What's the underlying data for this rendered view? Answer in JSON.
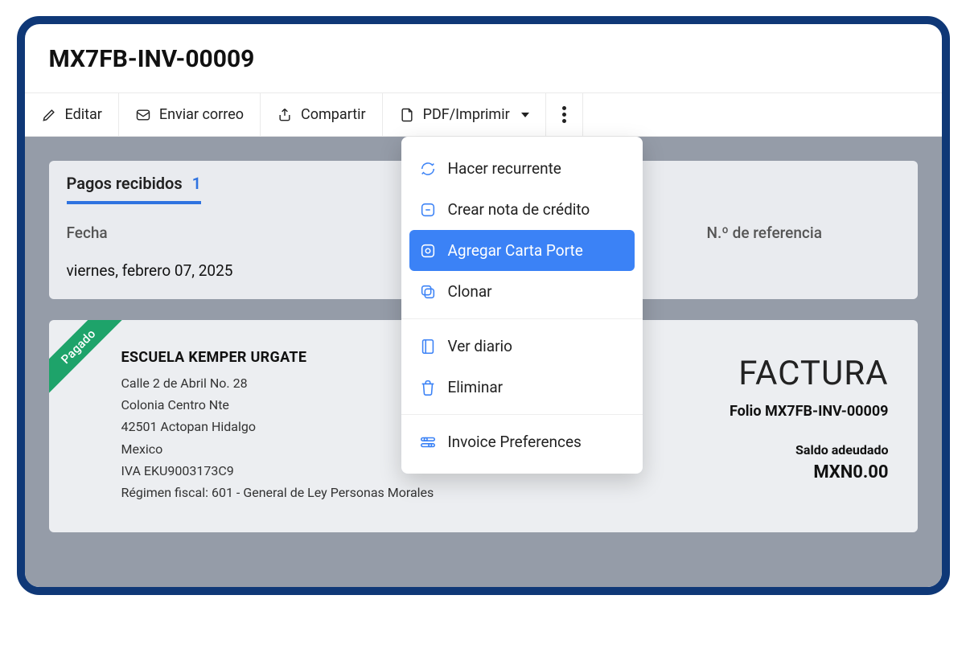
{
  "header": {
    "title": "MX7FB-INV-00009"
  },
  "toolbar": {
    "edit": "Editar",
    "email": "Enviar correo",
    "share": "Compartir",
    "pdf": "PDF/Imprimir"
  },
  "dropdown": {
    "recurring": "Hacer recurrente",
    "credit_note": "Crear nota de crédito",
    "carta_porte": "Agregar Carta Porte",
    "clone": "Clonar",
    "journal": "Ver diario",
    "delete": "Eliminar",
    "preferences": "Invoice Preferences"
  },
  "payments": {
    "tab_label": "Pagos recibidos",
    "count": "1",
    "col_date": "Fecha",
    "col_ref": "N.º de referencia",
    "rows": [
      {
        "date": "viernes, febrero 07, 2025",
        "ref": ""
      }
    ]
  },
  "invoice": {
    "ribbon": "Pagado",
    "issuer_name": "ESCUELA KEMPER URGATE",
    "addr1": "Calle 2 de Abril No. 28",
    "addr2": "Colonia Centro Nte",
    "addr3": "42501 Actopan Hidalgo",
    "addr4": "Mexico",
    "tax": "IVA EKU9003173C9",
    "regimen": "Régimen fiscal: 601 - General de Ley Personas Morales",
    "doc_label": "FACTURA",
    "folio_label": "Folio MX7FB-INV-00009",
    "balance_label": "Saldo adeudado",
    "balance_value": "MXN0.00"
  }
}
